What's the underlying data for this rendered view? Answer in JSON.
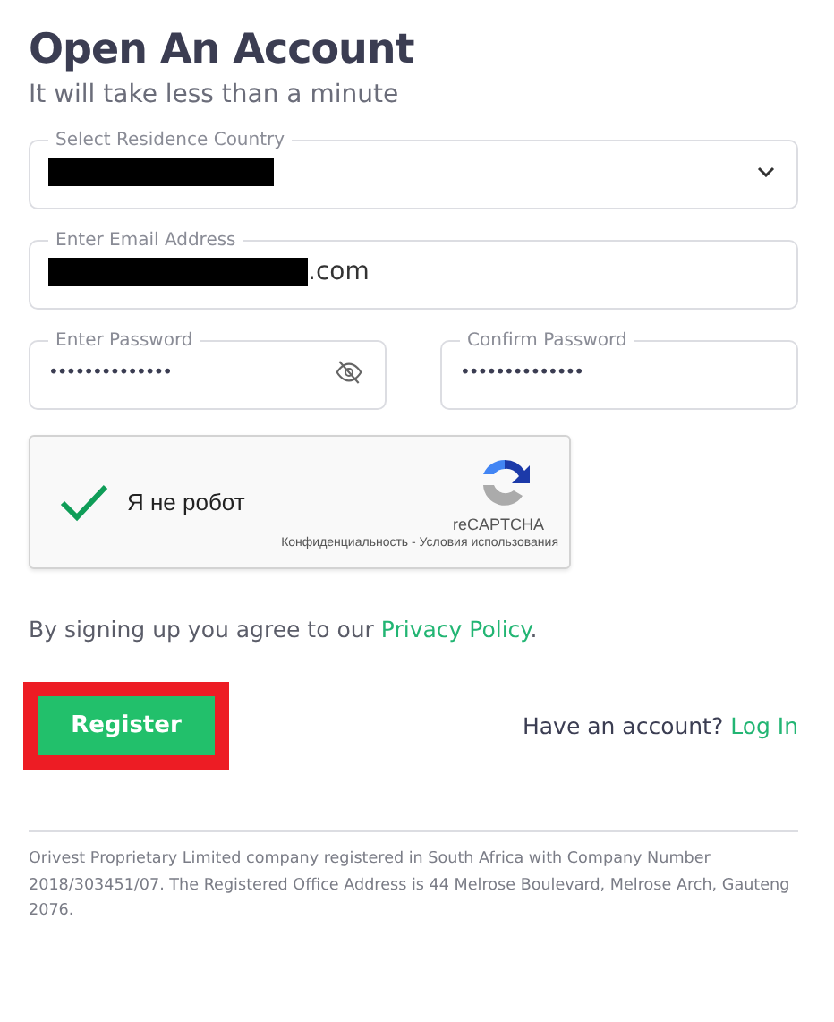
{
  "title": "Open An Account",
  "subtitle": "It will take less than a minute",
  "country": {
    "label": "Select Residence Country",
    "redacted": true
  },
  "email": {
    "label": "Enter Email Address",
    "redacted": true,
    "value": ".com"
  },
  "passwords": [
    {
      "label": "Enter Password",
      "value": "••••••••••••••",
      "eye": true
    },
    {
      "label": "Confirm Password",
      "value": "••••••••••••••",
      "eye": false
    }
  ],
  "captcha": {
    "checked": true,
    "label": "Я не робот",
    "brand": "reCAPTCHA",
    "terms": "Конфиденциальность - Условия использования"
  },
  "agreement": {
    "text": "By signing up you agree to our ",
    "link": "Privacy Policy",
    "after": "."
  },
  "register": {
    "label": "Register",
    "highlighted": true
  },
  "login": {
    "text": "Have an account? ",
    "link": "Log In"
  },
  "footer": "Orivest Proprietary Limited company registered in South Africa with Company Number 2018/303451/07. The Registered Office Address is 44 Melrose Boulevard, Melrose Arch, Gauteng 2076."
}
